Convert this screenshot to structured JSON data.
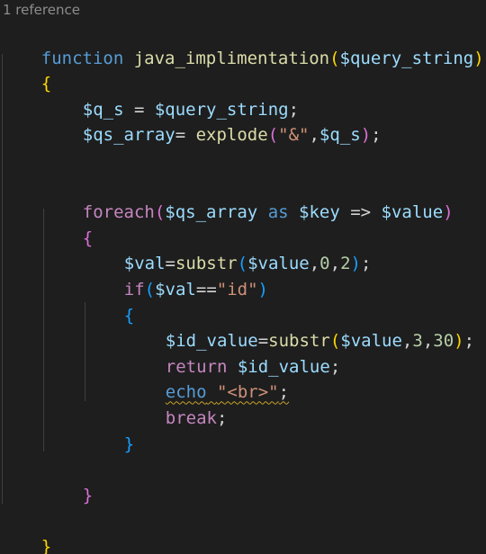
{
  "codelens": {
    "references": "1 reference"
  },
  "code": {
    "l1": {
      "kw": "function",
      "name": "java_implimentation",
      "open": "(",
      "param": "$query_string",
      "close": ")"
    },
    "l2": {
      "brace": "{"
    },
    "l3": {
      "lhs": "$q_s",
      "eq": " = ",
      "rhs": "$query_string",
      "semi": ";"
    },
    "l4": {
      "lhs": "$qs_array",
      "eq": "= ",
      "fn": "explode",
      "open": "(",
      "str": "\"&\"",
      "comma": ",",
      "arg": "$q_s",
      "close": ")",
      "semi": ";"
    },
    "l5": {
      "kw": "foreach",
      "open": "(",
      "arr": "$qs_array",
      "as": " as ",
      "key": "$key",
      "arrow": " => ",
      "val": "$value",
      "close": ")"
    },
    "l6": {
      "brace": "{"
    },
    "l7": {
      "lhs": "$val",
      "eq": "=",
      "fn": "substr",
      "open": "(",
      "arg": "$value",
      "c1": ",",
      "n1": "0",
      "c2": ",",
      "n2": "2",
      "close": ")",
      "semi": ";"
    },
    "l8": {
      "kw": "if",
      "open": "(",
      "var": "$val",
      "eq": "==",
      "str": "\"id\"",
      "close": ")"
    },
    "l9": {
      "brace": "{"
    },
    "l10": {
      "lhs": "$id_value",
      "eq": "=",
      "fn": "substr",
      "open": "(",
      "arg": "$value",
      "c1": ",",
      "n1": "3",
      "c2": ",",
      "n2": "30",
      "close": ")",
      "semi": ";"
    },
    "l11": {
      "kw": "return",
      "sp": " ",
      "var": "$id_value",
      "semi": ";"
    },
    "l12": {
      "kw": "echo",
      "sp": " ",
      "str": "\"<br>\"",
      "semi": ";"
    },
    "l13": {
      "kw": "break",
      "semi": ";"
    },
    "l14": {
      "brace": "}"
    },
    "l15": {
      "brace": "}"
    },
    "l16": {
      "brace": "}"
    }
  },
  "colors": {
    "background": "#1e1e1e",
    "keyword": "#569cd6",
    "control_keyword": "#c586c0",
    "function": "#dcdcaa",
    "variable": "#9cdcfe",
    "string": "#ce9178",
    "number": "#b5cea8",
    "bracket_level1": "#ffd700",
    "bracket_level2": "#da70d6",
    "bracket_level3": "#179fff",
    "warning_squiggle": "#c9a22a"
  }
}
